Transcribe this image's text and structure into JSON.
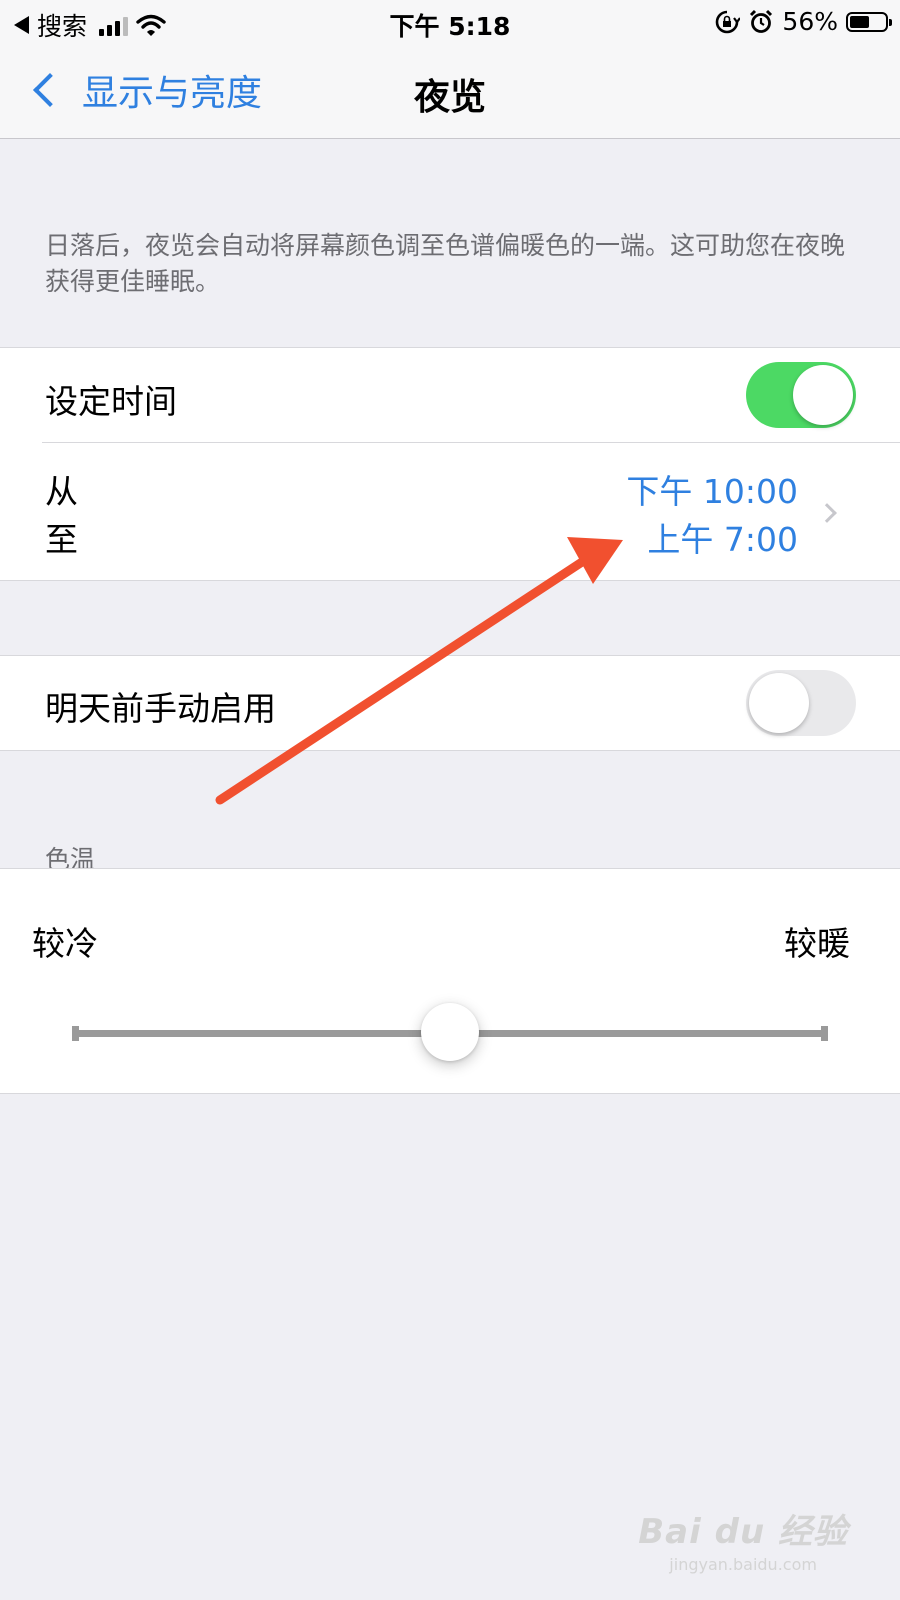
{
  "status_bar": {
    "back_app": "搜索",
    "time": "下午 5:18",
    "battery_text": "56%",
    "battery_level": 0.56
  },
  "nav": {
    "back_label": "显示与亮度",
    "title": "夜览"
  },
  "description": "日落后，夜览会自动将屏幕颜色调至色谱偏暖色的一端。这可助您在夜晚获得更佳睡眠。",
  "schedule": {
    "label": "设定时间",
    "enabled": true,
    "from_label": "从",
    "to_label": "至",
    "from_value": "下午 10:00",
    "to_value": "上午 7:00"
  },
  "manual": {
    "label": "明天前手动启用",
    "enabled": false
  },
  "color_temperature": {
    "header": "色温",
    "cooler_label": "较冷",
    "warmer_label": "较暖",
    "value": 0.5
  },
  "annotation": {
    "arrow_color": "#f1502f"
  },
  "colors": {
    "accent": "#2f80e0",
    "toggle_on": "#4cd964"
  },
  "watermark": {
    "logo": "Bai du 经验",
    "url": "jingyan.baidu.com"
  }
}
